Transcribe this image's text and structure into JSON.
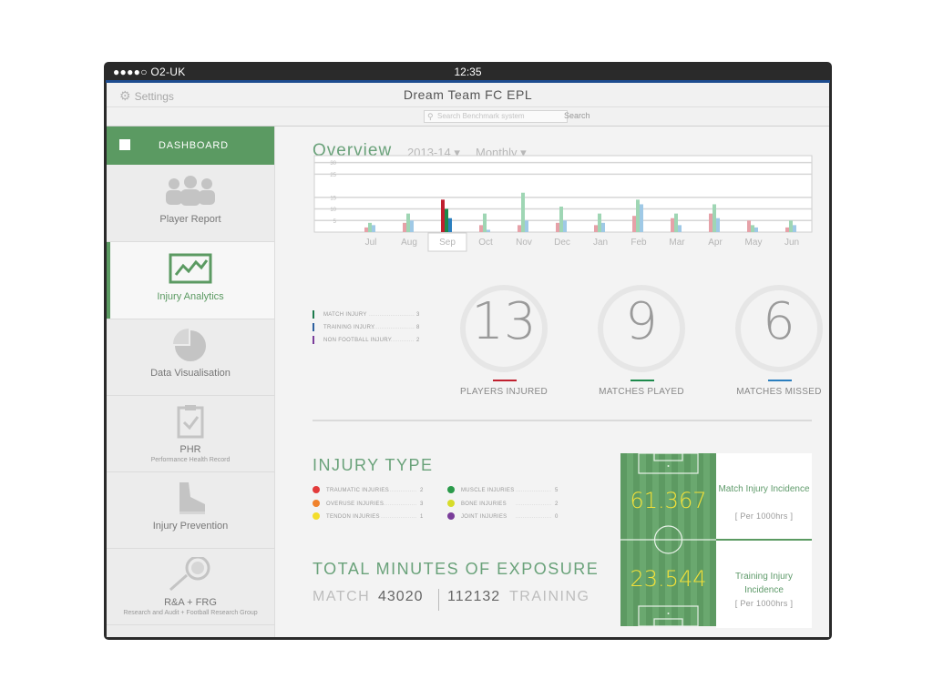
{
  "status_bar": {
    "carrier": "●●●●○ O2-UK",
    "time": "12:35"
  },
  "header": {
    "settings_label": "Settings",
    "settings_icon": "gear-icon",
    "title": "Dream Team FC EPL"
  },
  "search": {
    "placeholder": "Search Benchmark system",
    "button_label": "Search"
  },
  "sidebar": {
    "dashboard_label": "DASHBOARD",
    "items": [
      {
        "label": "Player Report",
        "sub": "",
        "icon": "users-icon"
      },
      {
        "label": "Injury Analytics",
        "sub": "",
        "icon": "line-chart-icon",
        "active": true
      },
      {
        "label": "Data Visualisation",
        "sub": "",
        "icon": "pie-chart-icon"
      },
      {
        "label": "PHR",
        "sub": "Performance Health Record",
        "icon": "clipboard-check-icon"
      },
      {
        "label": "Injury Prevention",
        "sub": "",
        "icon": "boot-icon"
      },
      {
        "label": "R&A + FRG",
        "sub": "Research and Audit + Football Research Group",
        "icon": "racket-ball-icon"
      }
    ]
  },
  "overview": {
    "title": "Overview",
    "season": "2013-14 ▾",
    "period": "Monthly ▾"
  },
  "chart_data": {
    "type": "bar",
    "categories": [
      "Jul",
      "Aug",
      "Sep",
      "Oct",
      "Nov",
      "Dec",
      "Jan",
      "Feb",
      "Mar",
      "Apr",
      "May",
      "Jun"
    ],
    "selected_category": "Sep",
    "yticks": [
      5,
      10,
      15,
      25,
      30
    ],
    "ylim": [
      0,
      33
    ],
    "grid": true,
    "series": [
      {
        "name": "",
        "color": "#e6a1a8",
        "values": [
          2,
          4,
          0,
          3,
          3,
          4,
          3,
          7,
          6,
          8,
          5,
          2
        ]
      },
      {
        "name": "",
        "color": "#9fd6b4",
        "values": [
          4,
          8,
          0,
          8,
          17,
          11,
          8,
          14,
          8,
          12,
          3,
          5
        ]
      },
      {
        "name": "",
        "color": "#9fc9e6",
        "values": [
          3,
          5,
          0,
          1,
          5,
          5,
          4,
          12,
          3,
          6,
          2,
          3
        ]
      }
    ],
    "highlight": {
      "category": "Sep",
      "colors": [
        "#c0202f",
        "#1d8a4c",
        "#2b7fbf"
      ],
      "values": [
        14,
        10,
        6
      ]
    }
  },
  "injury_legend": [
    {
      "label": "MATCH INJURY",
      "value": "3",
      "color": "#1d7a4c"
    },
    {
      "label": "TRAINING INJURY",
      "value": "8",
      "color": "#2c5f9e"
    },
    {
      "label": "NON FOOTBALL INJURY",
      "value": "2",
      "color": "#7a3d9a"
    }
  ],
  "stats": [
    {
      "value": "13",
      "label": "PLAYERS INJURED",
      "color": "#c0202f"
    },
    {
      "value": "9",
      "label": "MATCHES PLAYED",
      "color": "#1d8a4c"
    },
    {
      "value": "6",
      "label": "MATCHES MISSED",
      "color": "#2b7fbf"
    }
  ],
  "injury_type": {
    "title": "INJURY TYPE",
    "left": [
      {
        "label": "TRAUMATIC INJURIES",
        "value": "2",
        "color": "#e23a3a"
      },
      {
        "label": "OVERUSE INJURIES",
        "value": "3",
        "color": "#f0822c"
      },
      {
        "label": "TENDON INJURIES",
        "value": "1",
        "color": "#f3dd2b"
      }
    ],
    "right": [
      {
        "label": "MUSCLE INJURIES",
        "value": "5",
        "color": "#2a9a4a"
      },
      {
        "label": "BONE INJURIES",
        "value": "2",
        "color": "#d7dc2a"
      },
      {
        "label": "JOINT INJURIES",
        "value": "0",
        "color": "#7a3d9a"
      }
    ]
  },
  "exposure": {
    "title": "TOTAL MINUTES OF EXPOSURE",
    "match_label": "MATCH",
    "match_value": "43020",
    "training_value": "112132",
    "training_label": "TRAINING"
  },
  "incidence": [
    {
      "value": "61.367",
      "title": "Match Injury Incidence",
      "sub": "[ Per 1000hrs ]"
    },
    {
      "value": "23.544",
      "title": "Training Injury Incidence",
      "sub": "[ Per 1000hrs ]"
    }
  ]
}
